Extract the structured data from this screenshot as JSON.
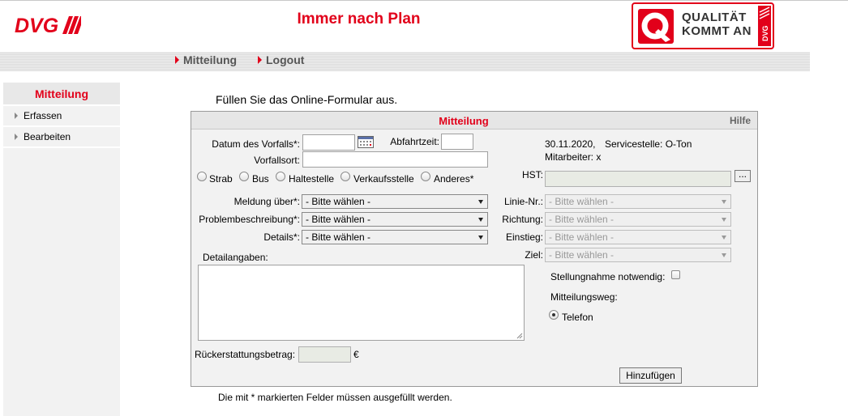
{
  "header": {
    "logo_text": "DVG",
    "app_title": "Immer nach Plan",
    "badge_line1": "QUALITÄT",
    "badge_line2": "KOMMT AN",
    "badge_side": "DVG"
  },
  "nav": [
    {
      "label": "Mitteilung",
      "icon": "triangle-right-icon"
    },
    {
      "label": "Logout",
      "icon": "triangle-right-icon"
    }
  ],
  "sidebar": {
    "heading": "Mitteilung",
    "items": [
      {
        "label": "Erfassen",
        "icon": "triangle-right-icon"
      },
      {
        "label": "Bearbeiten",
        "icon": "triangle-right-icon"
      }
    ]
  },
  "intro_text": "Füllen Sie das Online-Formular aus.",
  "form": {
    "title": "Mitteilung",
    "help_label": "Hilfe",
    "date_label": "Datum des Vorfalls*:",
    "date_value": "",
    "calendar_icon": "calendar-icon",
    "departure_label": "Abfahrtzeit:",
    "departure_value": "",
    "place_label": "Vorfallsort:",
    "place_value": "",
    "info_date": "30.11.2020,",
    "info_service": "Servicestelle: O-Ton",
    "info_staff": "Mitarbeiter: x",
    "radios": [
      {
        "label": "Strab",
        "checked": false
      },
      {
        "label": "Bus",
        "checked": false
      },
      {
        "label": "Haltestelle",
        "checked": false
      },
      {
        "label": "Verkaufsstelle",
        "checked": false
      },
      {
        "label": "Anderes*",
        "checked": false
      }
    ],
    "hst_label": "HST:",
    "hst_value": "",
    "hst_button": "...",
    "selects_left": [
      {
        "label": "Meldung über*:",
        "value": "- Bitte wählen -"
      },
      {
        "label": "Problembeschreibung*:",
        "value": "- Bitte wählen -"
      },
      {
        "label": "Details*:",
        "value": "- Bitte wählen -"
      }
    ],
    "selects_right": [
      {
        "label": "Linie-Nr.:",
        "value": "- Bitte wählen -"
      },
      {
        "label": "Richtung:",
        "value": "- Bitte wählen -"
      },
      {
        "label": "Einstieg:",
        "value": "- Bitte wählen -"
      },
      {
        "label": "Ziel:",
        "value": "- Bitte wählen -"
      }
    ],
    "details_label": "Detailangaben:",
    "details_value": "",
    "statement_label": "Stellungnahme notwendig:",
    "statement_checked": false,
    "channel_label": "Mitteilungsweg:",
    "channel_option": "Telefon",
    "channel_checked": true,
    "refund_label": "Rückerstattungsbetrag:",
    "refund_value": "",
    "currency": "€",
    "submit_label": "Hinzufügen"
  },
  "footnote": "Die mit * markierten Felder müssen ausgefüllt werden.",
  "colors": {
    "accent": "#e2001a",
    "panel_bg": "#f2f2f2"
  }
}
